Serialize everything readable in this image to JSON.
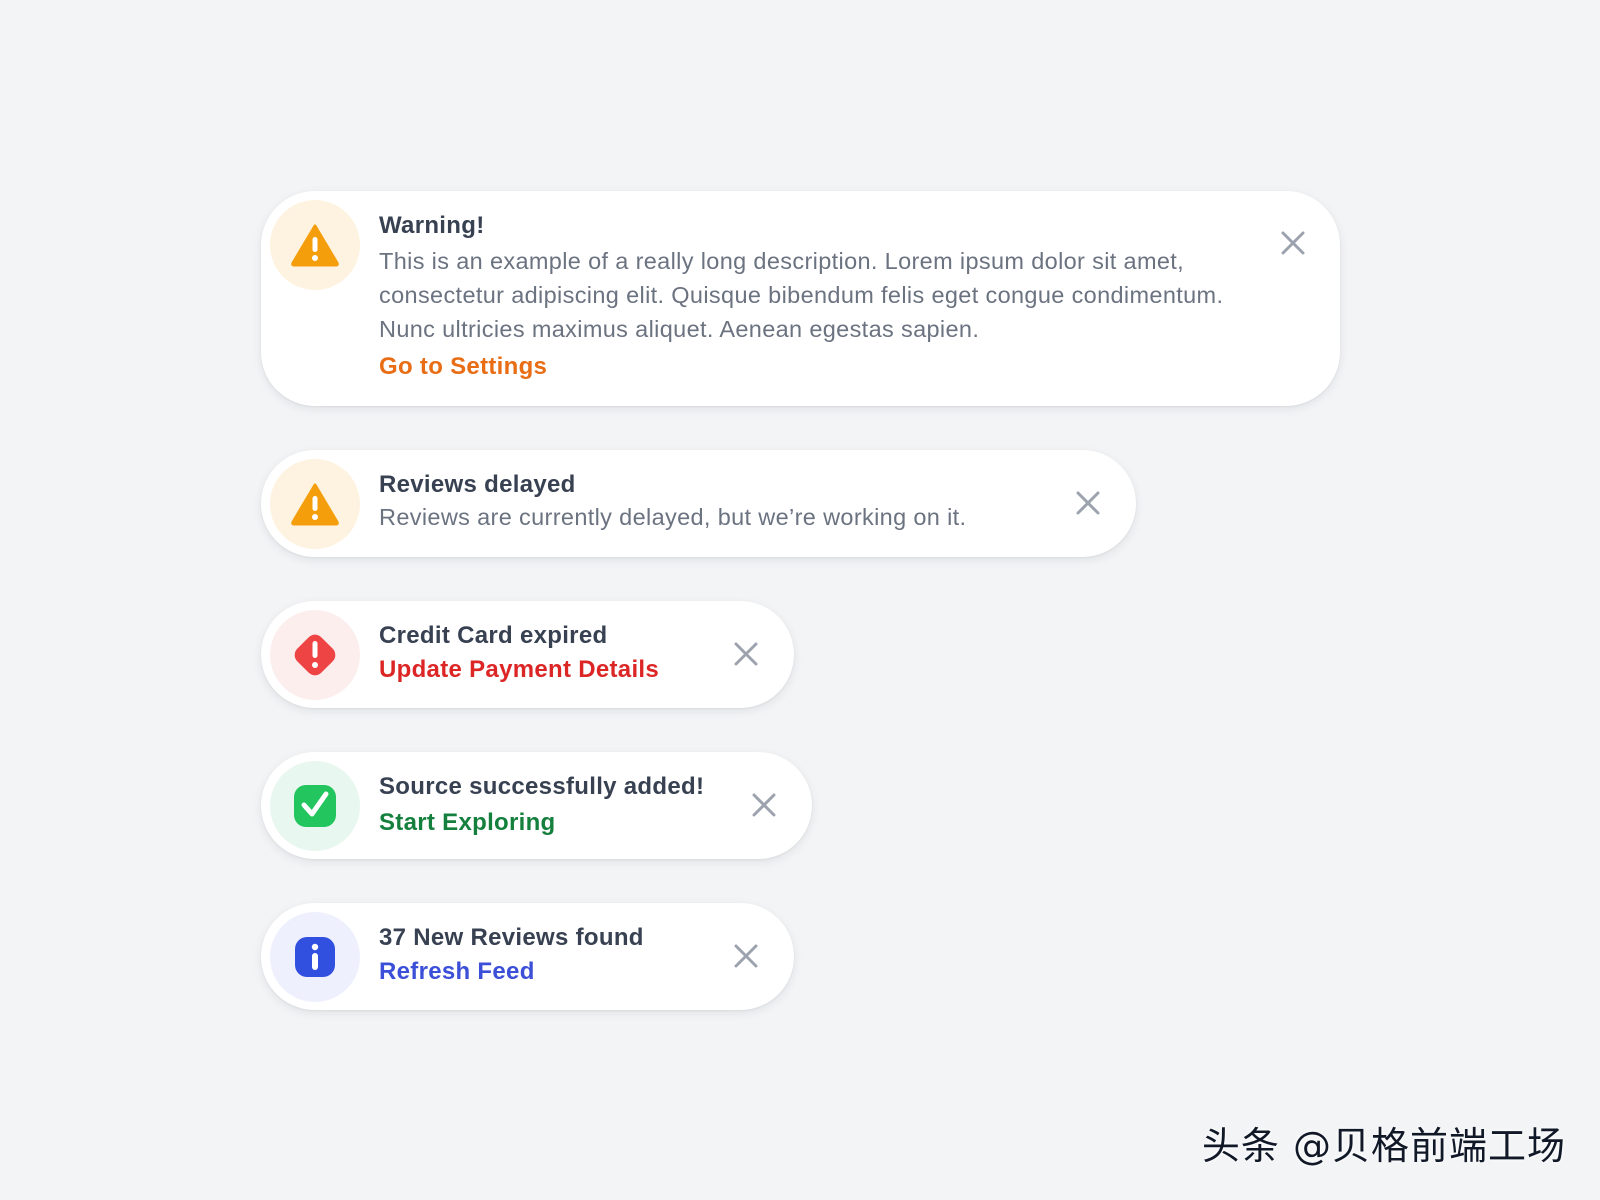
{
  "notifications": [
    {
      "type": "warning",
      "icon": "warning-triangle-icon",
      "title": "Warning!",
      "description": "This is an example of a really long description. Lorem ipsum dolor sit amet, consectetur adipiscing elit. Quisque bibendum felis eget congue condimentum. Nunc ultricies maximus aliquet. Aenean egestas sapien.",
      "action": "Go to Settings",
      "close_icon": "close-icon"
    },
    {
      "type": "warning",
      "icon": "warning-triangle-icon",
      "title": "Reviews delayed",
      "description": "Reviews are currently delayed, but we’re working on it.",
      "close_icon": "close-icon"
    },
    {
      "type": "error",
      "icon": "error-diamond-icon",
      "title": "Credit Card expired",
      "action": "Update Payment Details",
      "close_icon": "close-icon"
    },
    {
      "type": "success",
      "icon": "success-check-icon",
      "title": "Source successfully added!",
      "action": "Start Exploring",
      "close_icon": "close-icon"
    },
    {
      "type": "info",
      "icon": "info-icon",
      "title": "37 New Reviews found",
      "action": "Refresh Feed",
      "close_icon": "close-icon"
    }
  ],
  "colors": {
    "background": "#f3f4f6",
    "card": "#ffffff",
    "title": "#374151",
    "description": "#6b7280",
    "warning_icon": "#f59e0b",
    "warning_bg": "#fef3e0",
    "warning_action": "#e86d14",
    "error_icon": "#ef4444",
    "error_bg": "#fdeeee",
    "error_action": "#dc2626",
    "success_icon": "#22c55e",
    "success_bg": "#e8f7ef",
    "success_action": "#15803d",
    "info_icon": "#3150e0",
    "info_bg": "#eef0fd",
    "info_action": "#3b4fd8",
    "close": "#9ca3af"
  },
  "watermark": "头条 @贝格前端工场"
}
